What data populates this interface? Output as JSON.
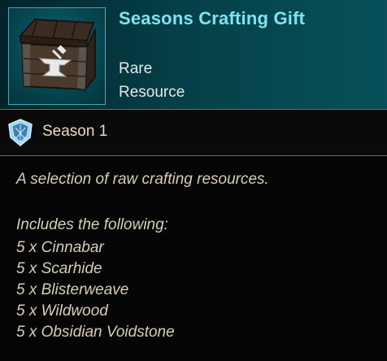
{
  "item": {
    "name": "Seasons Crafting Gift",
    "rarity": "Rare",
    "type": "Resource",
    "icon": "anvil-chest-icon"
  },
  "season": {
    "label": "Season 1",
    "icon": "season-shield-icon"
  },
  "description": "A selection of raw crafting resources.",
  "includes_heading": "Includes the following:",
  "contents": [
    "5 x Cinnabar",
    "5 x Scarhide",
    "5 x Blisterweave",
    "5 x Wildwood",
    "5 x Obsidian Voidstone"
  ],
  "colors": {
    "name": "#7ee3f2",
    "header_bg": "#053f47",
    "divider": "#7a6a4a",
    "body_text": "#d8cdb6"
  }
}
